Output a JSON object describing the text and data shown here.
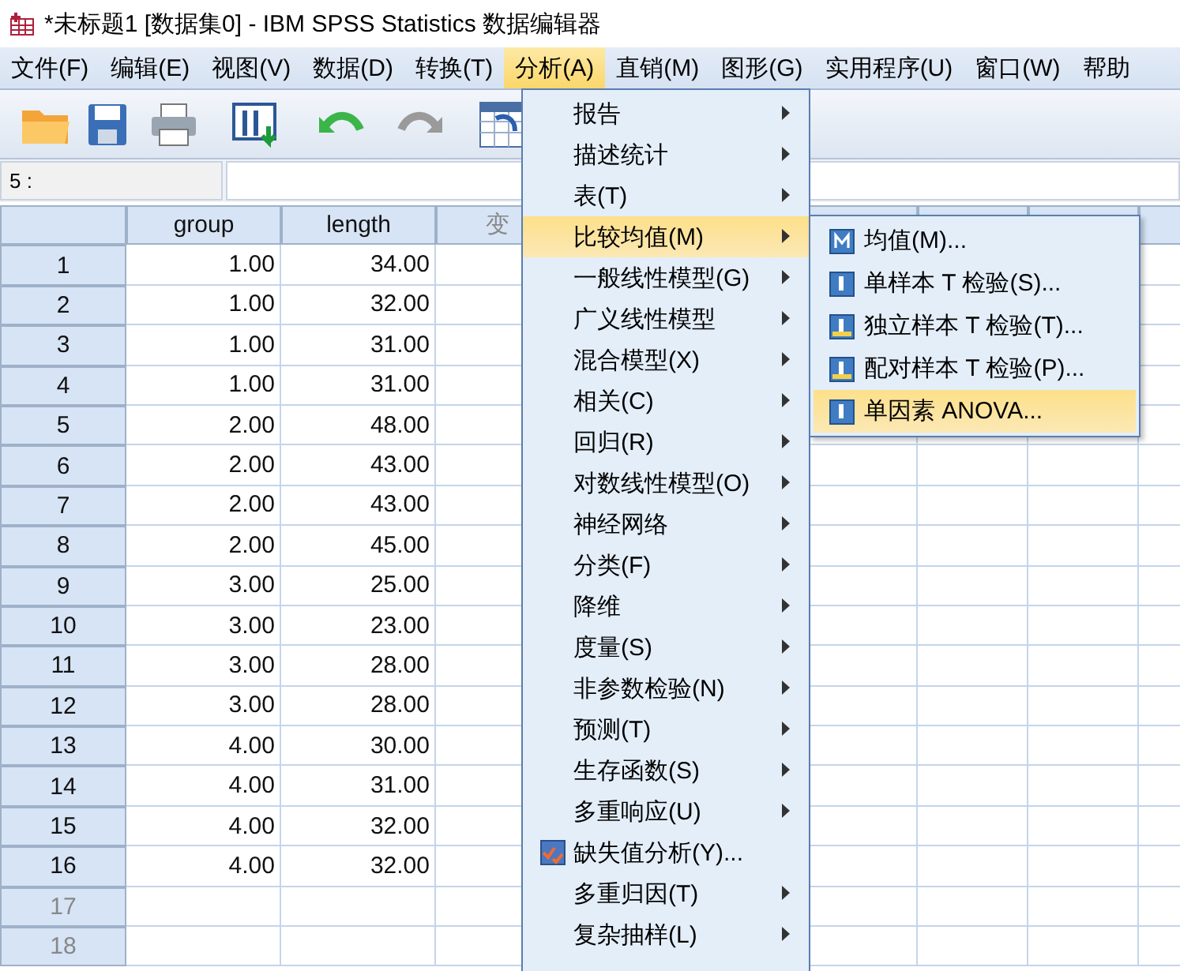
{
  "window": {
    "title": "*未标题1 [数据集0] - IBM SPSS Statistics 数据编辑器"
  },
  "menu_bar": [
    {
      "label": "文件(F)",
      "selected": false
    },
    {
      "label": "编辑(E)",
      "selected": false
    },
    {
      "label": "视图(V)",
      "selected": false
    },
    {
      "label": "数据(D)",
      "selected": false
    },
    {
      "label": "转换(T)",
      "selected": false
    },
    {
      "label": "分析(A)",
      "selected": true
    },
    {
      "label": "直销(M)",
      "selected": false
    },
    {
      "label": "图形(G)",
      "selected": false
    },
    {
      "label": "实用程序(U)",
      "selected": false
    },
    {
      "label": "窗口(W)",
      "selected": false
    },
    {
      "label": "帮助",
      "selected": false
    }
  ],
  "cell_reference": {
    "label": "5 :"
  },
  "grid": {
    "columns": [
      {
        "label": "group",
        "unnamed": false
      },
      {
        "label": "length",
        "unnamed": false
      },
      {
        "label": "变",
        "unnamed": true
      }
    ],
    "rows": [
      {
        "number": "1",
        "greyed": false,
        "values": [
          "1.00",
          "34.00"
        ]
      },
      {
        "number": "2",
        "greyed": false,
        "values": [
          "1.00",
          "32.00"
        ]
      },
      {
        "number": "3",
        "greyed": false,
        "values": [
          "1.00",
          "31.00"
        ]
      },
      {
        "number": "4",
        "greyed": false,
        "values": [
          "1.00",
          "31.00"
        ]
      },
      {
        "number": "5",
        "greyed": false,
        "values": [
          "2.00",
          "48.00"
        ]
      },
      {
        "number": "6",
        "greyed": false,
        "values": [
          "2.00",
          "43.00"
        ]
      },
      {
        "number": "7",
        "greyed": false,
        "values": [
          "2.00",
          "43.00"
        ]
      },
      {
        "number": "8",
        "greyed": false,
        "values": [
          "2.00",
          "45.00"
        ]
      },
      {
        "number": "9",
        "greyed": false,
        "values": [
          "3.00",
          "25.00"
        ]
      },
      {
        "number": "10",
        "greyed": false,
        "values": [
          "3.00",
          "23.00"
        ]
      },
      {
        "number": "11",
        "greyed": false,
        "values": [
          "3.00",
          "28.00"
        ]
      },
      {
        "number": "12",
        "greyed": false,
        "values": [
          "3.00",
          "28.00"
        ]
      },
      {
        "number": "13",
        "greyed": false,
        "values": [
          "4.00",
          "30.00"
        ]
      },
      {
        "number": "14",
        "greyed": false,
        "values": [
          "4.00",
          "31.00"
        ]
      },
      {
        "number": "15",
        "greyed": false,
        "values": [
          "4.00",
          "32.00"
        ]
      },
      {
        "number": "16",
        "greyed": false,
        "values": [
          "4.00",
          "32.00"
        ]
      },
      {
        "number": "17",
        "greyed": true
      },
      {
        "number": "18",
        "greyed": true
      }
    ]
  },
  "analyze_menu": [
    {
      "label": "报告",
      "kind": "submenu",
      "selected": false
    },
    {
      "label": "描述统计",
      "kind": "submenu",
      "selected": false
    },
    {
      "label": "表(T)",
      "kind": "submenu",
      "selected": false
    },
    {
      "label": "比较均值(M)",
      "kind": "submenu",
      "selected": true
    },
    {
      "label": "一般线性模型(G)",
      "kind": "submenu",
      "selected": false
    },
    {
      "label": "广义线性模型",
      "kind": "submenu",
      "selected": false
    },
    {
      "label": "混合模型(X)",
      "kind": "submenu",
      "selected": false
    },
    {
      "label": "相关(C)",
      "kind": "submenu",
      "selected": false
    },
    {
      "label": "回归(R)",
      "kind": "submenu",
      "selected": false
    },
    {
      "label": "对数线性模型(O)",
      "kind": "submenu",
      "selected": false
    },
    {
      "label": "神经网络",
      "kind": "submenu",
      "selected": false
    },
    {
      "label": "分类(F)",
      "kind": "submenu",
      "selected": false
    },
    {
      "label": "降维",
      "kind": "submenu",
      "selected": false
    },
    {
      "label": "度量(S)",
      "kind": "submenu",
      "selected": false
    },
    {
      "label": "非参数检验(N)",
      "kind": "submenu",
      "selected": false
    },
    {
      "label": "预测(T)",
      "kind": "submenu",
      "selected": false
    },
    {
      "label": "生存函数(S)",
      "kind": "submenu",
      "selected": false
    },
    {
      "label": "多重响应(U)",
      "kind": "submenu",
      "selected": false
    },
    {
      "label": "缺失值分析(Y)...",
      "kind": "dialog",
      "selected": false
    },
    {
      "label": "多重归因(T)",
      "kind": "submenu",
      "selected": false
    },
    {
      "label": "复杂抽样(L)",
      "kind": "submenu",
      "selected": false
    }
  ],
  "compare_means_menu": [
    {
      "label": "均值(M)...",
      "selected": false
    },
    {
      "label": "单样本 T 检验(S)...",
      "selected": false
    },
    {
      "label": "独立样本 T 检验(T)...",
      "selected": false
    },
    {
      "label": "配对样本 T 检验(P)...",
      "selected": false
    },
    {
      "label": "单因素 ANOVA...",
      "selected": true
    }
  ]
}
